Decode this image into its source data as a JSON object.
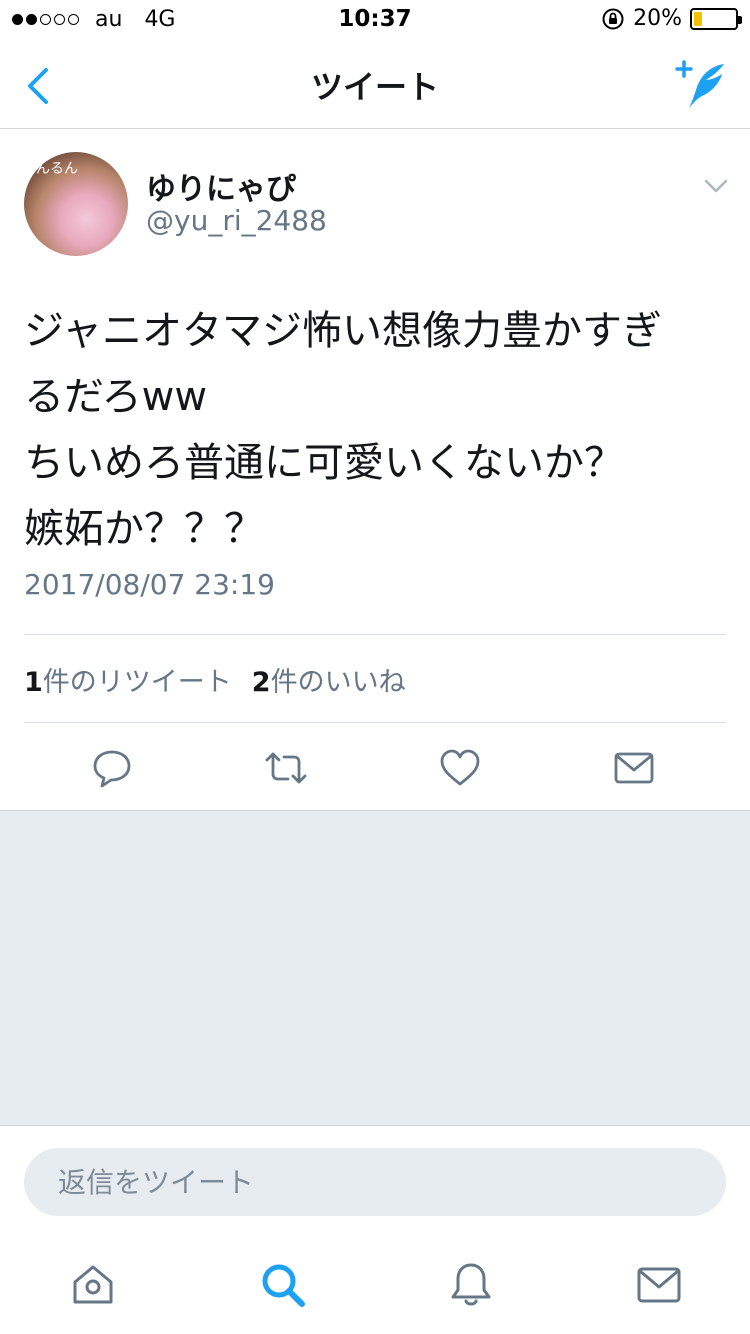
{
  "status_bar": {
    "carrier": "au",
    "network": "4G",
    "time": "10:37",
    "battery": "20%",
    "battery_level": 0.2,
    "signal_bars": 2
  },
  "nav": {
    "title": "ツイート",
    "back_icon": "chevron-left-icon",
    "compose_icon": "compose-tweet-icon"
  },
  "tweet": {
    "display_name": "ゆりにゃぴ",
    "handle": "@yu_ri_2488",
    "avatar_text": "んるん",
    "lines": [
      "ジャニオタマジ怖い想像力豊かすぎ",
      "るだろww",
      "ちいめろ普通に可愛いくないか？",
      "嫉妬か？？？"
    ],
    "timestamp": "2017/08/07 23:19",
    "retweet_count": "1",
    "retweet_label": "件のリツイート",
    "like_count": "2",
    "like_label": "件のいいね"
  },
  "reply": {
    "placeholder": "返信をツイート"
  },
  "colors": {
    "accent": "#1da1f2",
    "text": "#14171a",
    "muted": "#657786",
    "background_gray": "#e6ecf0",
    "battery": "#f2c200"
  },
  "tab_bar": {
    "items": [
      "home-icon",
      "search-icon",
      "notifications-icon",
      "messages-icon"
    ],
    "active": "search-icon"
  }
}
